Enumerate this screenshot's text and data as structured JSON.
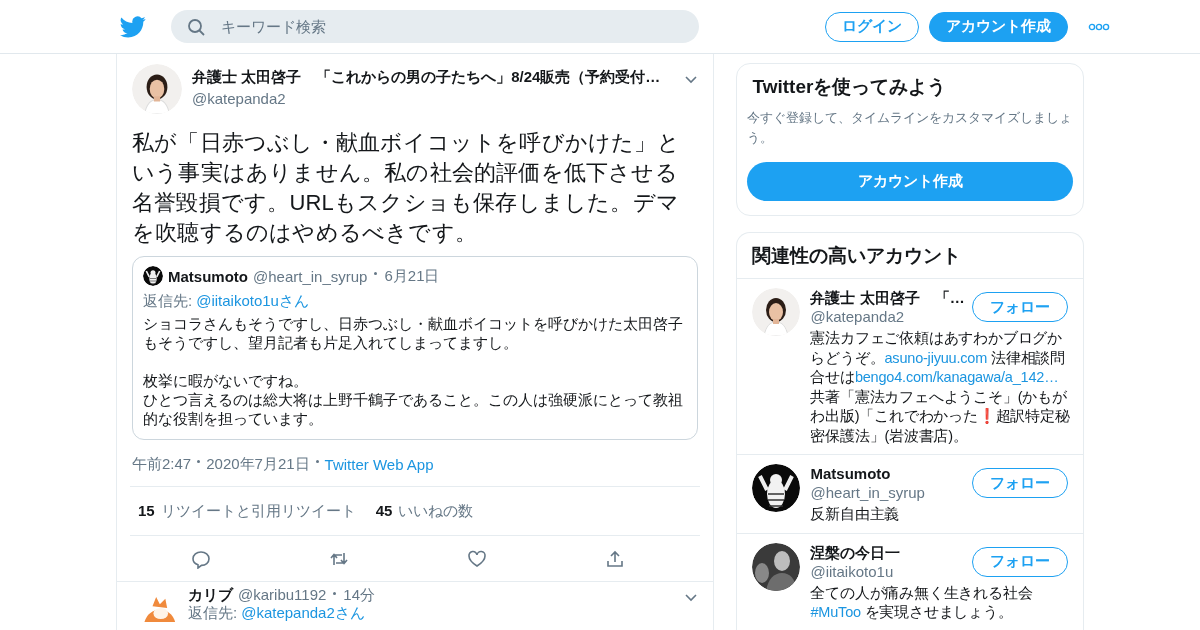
{
  "header": {
    "search": {
      "placeholder": "キーワード検索"
    },
    "buttons": [
      {
        "label": "ログイン",
        "kind": "outline"
      },
      {
        "label": "アカウント作成",
        "kind": "filled"
      }
    ]
  },
  "tweet": {
    "author": {
      "name": "弁護士 太田啓子　「これからの男の子たちへ」8/24販売（予約受付…",
      "handle": "@katepanda2"
    },
    "text": "私が「日赤つぶし・献血ボイコットを呼びかけた」という事実はありません。私の社会的評価を低下させる名誉毀損です。URLもスクショも保存しました。デマを吹聴するのはやめるべきです。",
    "quote": {
      "name": "Matsumoto",
      "handle": "@heart_in_syrup",
      "date": "6月21日",
      "reply_label": "返信先:",
      "reply_to": "@iitaikoto1uさん",
      "paragraphs": [
        "ショコラさんもそうですし、日赤つぶし・献血ボイコットを呼びかけた太田啓子もそうですし、望月記者も片足入れてしまってますし。",
        "枚挙に暇がないですね。",
        "ひとつ言えるのは総大将は上野千鶴子であること。この人は強硬派にとって教祖的な役割を担っています。"
      ]
    },
    "time": "午前2:47",
    "date": "2020年7月21日",
    "source": "Twitter Web App",
    "stats": [
      {
        "count": "15",
        "label": "リツイートと引用リツイート"
      },
      {
        "count": "45",
        "label": "いいねの数"
      }
    ],
    "actions": [
      {
        "kind": "reply"
      },
      {
        "kind": "retweet"
      },
      {
        "kind": "like"
      },
      {
        "kind": "share"
      }
    ]
  },
  "reply": {
    "name": "カリブ",
    "handle": "@karibu1192",
    "time": "14分",
    "reply_label": "返信先:",
    "reply_to": "@katepanda2さん"
  },
  "signup_card": {
    "title": "Twitterを使ってみよう",
    "text": "今すぐ登録して、タイムラインをカスタマイズしましょう。",
    "button": "アカウント作成"
  },
  "accounts_card": {
    "title": "関連性の高いアカウント",
    "accounts": [
      {
        "name": "弁護士 太田啓子　「…",
        "handle": "@katepanda2",
        "button": "フォロー",
        "bio": [
          {
            "kind": "text",
            "text": "憲法カフェご依頼はあすわかブログからどうぞ。"
          },
          {
            "kind": "link",
            "text": "asuno-jiyuu.com"
          },
          {
            "kind": "text",
            "text": " 法律相談問合せは"
          },
          {
            "kind": "link",
            "text": "bengo4.com/kanagawa/a_142…"
          },
          {
            "kind": "text",
            "text": " 共著「憲法カフェへようこそ」(かもがわ出版)「これでわかった❗超訳特定秘密保護法」(岩波書店)。"
          }
        ]
      },
      {
        "name": "Matsumoto",
        "handle": "@heart_in_syrup",
        "button": "フォロー",
        "bio": [
          {
            "kind": "text",
            "text": "反新自由主義"
          }
        ]
      },
      {
        "name": "涅槃の今日一",
        "handle": "@iitaikoto1u",
        "button": "フォロー",
        "bio": [
          {
            "kind": "text",
            "text": "全ての人が痛み無く生きれる社会"
          },
          {
            "kind": "link",
            "text": "#MuToo"
          },
          {
            "kind": "text",
            "text": " を実現させましょう。"
          }
        ]
      }
    ]
  }
}
